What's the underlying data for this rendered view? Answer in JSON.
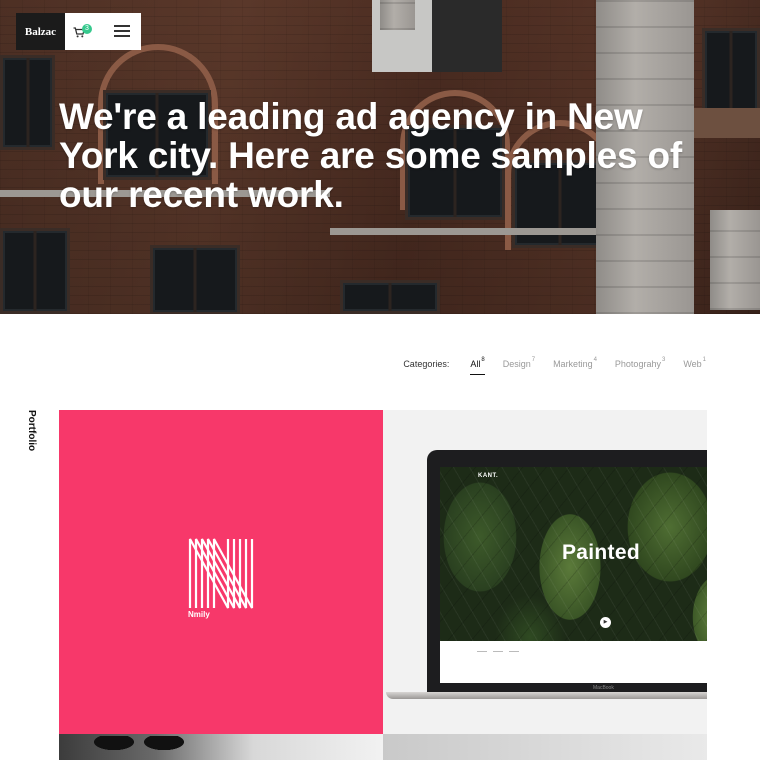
{
  "brand": {
    "logo": "Balzac"
  },
  "toolbar": {
    "cart_icon": "cart-icon",
    "cart_count": "3",
    "menu_icon": "hamburger-menu-icon"
  },
  "hero": {
    "headline": "We're a leading ad agency in New York city. Here are some samples of our recent work."
  },
  "filters": {
    "label": "Categories:",
    "items": [
      {
        "label": "All",
        "count": "8",
        "active": true
      },
      {
        "label": "Design",
        "count": "7",
        "active": false
      },
      {
        "label": "Marketing",
        "count": "4",
        "active": false
      },
      {
        "label": "Photograhy",
        "count": "3",
        "active": false
      },
      {
        "label": "Web",
        "count": "1",
        "active": false
      }
    ]
  },
  "side_label": "Portfolio",
  "portfolio": {
    "items": [
      {
        "caption": "Nmily",
        "color": "#f7386a"
      },
      {
        "brand": "KANT.",
        "title": "Painted",
        "device_label": "MacBook"
      }
    ]
  },
  "colors": {
    "accent_pink": "#f7386a",
    "badge_green": "#37c98e"
  }
}
